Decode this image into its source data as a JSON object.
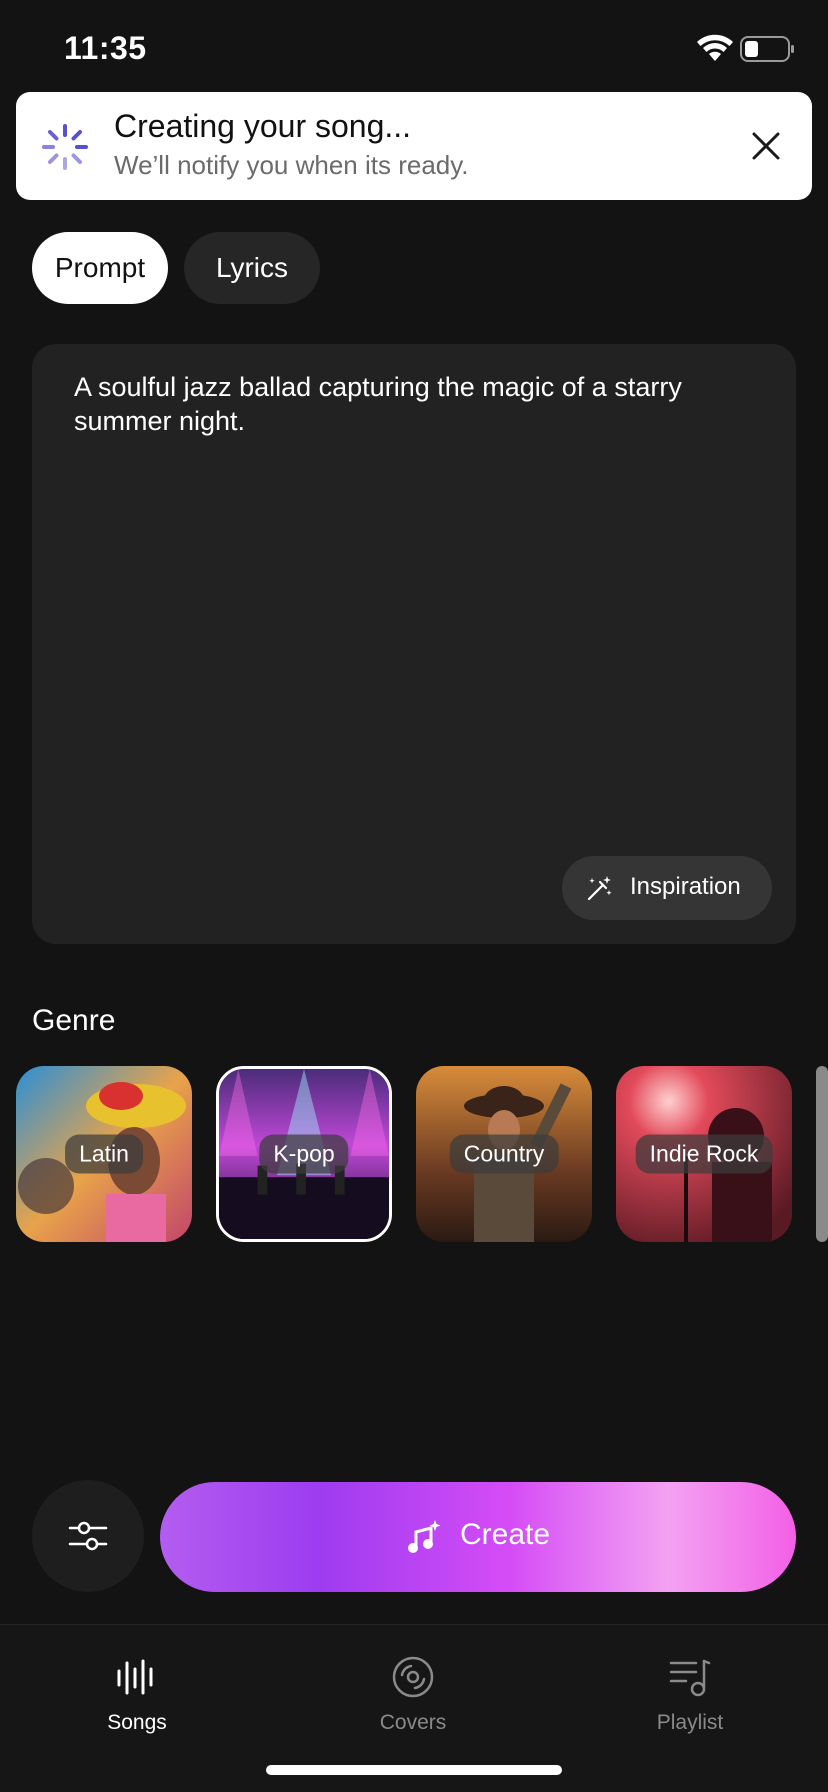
{
  "status_bar": {
    "time": "11:35",
    "wifi_icon": "wifi-icon",
    "battery_icon": "battery-icon"
  },
  "toast": {
    "title": "Creating your song...",
    "subtitle": "We’ll notify you when its ready.",
    "spinner_icon": "spinner-icon",
    "spinner_color": "#5a4fcf",
    "close_icon": "close-icon"
  },
  "tabs": [
    {
      "label": "Prompt",
      "selected": true
    },
    {
      "label": "Lyrics",
      "selected": false
    }
  ],
  "prompt": {
    "text": "A soulful jazz ballad capturing the magic of a starry summer night.",
    "inspiration_label": "Inspiration",
    "inspiration_icon": "magic-wand-icon"
  },
  "genre": {
    "title": "Genre",
    "items": [
      {
        "label": "Latin",
        "selected": false
      },
      {
        "label": "K-pop",
        "selected": true
      },
      {
        "label": "Country",
        "selected": false
      },
      {
        "label": "Indie Rock",
        "selected": false
      }
    ]
  },
  "actions": {
    "settings_icon": "sliders-icon",
    "create_label": "Create",
    "create_icon": "music-sparkle-icon",
    "create_gradient": [
      "#b35df0",
      "#9d3cf0",
      "#d54cf6",
      "#f3a2f2",
      "#f35fe6"
    ]
  },
  "bottom_nav": [
    {
      "label": "Songs",
      "icon": "waveform-icon",
      "active": true
    },
    {
      "label": "Covers",
      "icon": "disc-icon",
      "active": false
    },
    {
      "label": "Playlist",
      "icon": "playlist-icon",
      "active": false
    }
  ]
}
